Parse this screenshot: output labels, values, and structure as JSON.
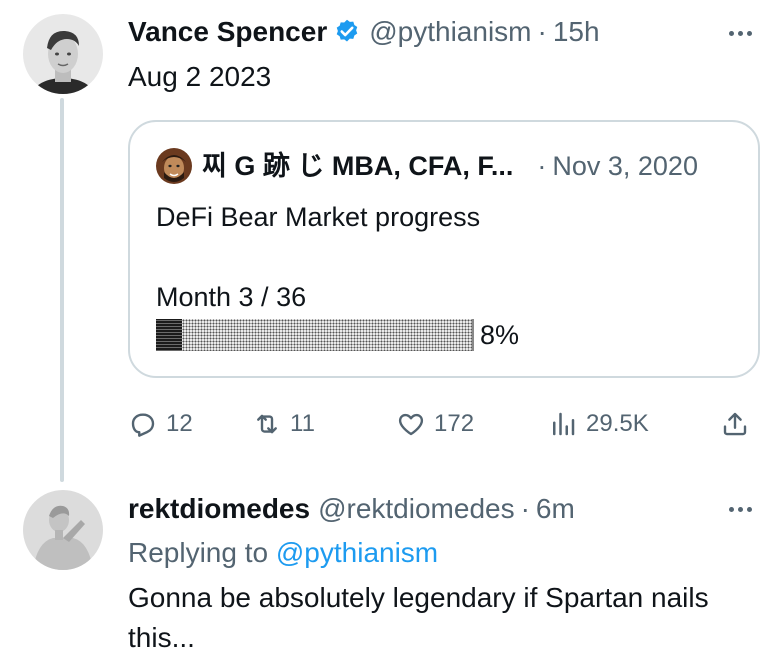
{
  "colors": {
    "text_primary": "#0f1419",
    "text_secondary": "#536471",
    "accent_blue": "#1d9bf0",
    "border": "#cfd9de"
  },
  "tweet1": {
    "author_name": "Vance Spencer",
    "verified_icon": "verified-badge-icon",
    "handle": "@pythianism",
    "separator": "·",
    "time": "15h",
    "text": "Aug 2 2023",
    "quote": {
      "author_name": "찌 G 跡 じ MBA, CFA, F...",
      "separator": "·",
      "date": "Nov 3, 2020",
      "line1": "DeFi Bear Market progress",
      "line2": "Month 3 / 36",
      "progress_fraction": 0.083,
      "progress_label": "8%"
    },
    "actions": {
      "replies": "12",
      "retweets": "11",
      "likes": "172",
      "views": "29.5K"
    }
  },
  "tweet2": {
    "author_name": "rektdiomedes",
    "handle": "@rektdiomedes",
    "separator": "·",
    "time": "6m",
    "replying_prefix": "Replying to",
    "replying_to": "@pythianism",
    "text": "Gonna be absolutely legendary if Spartan nails this..."
  }
}
